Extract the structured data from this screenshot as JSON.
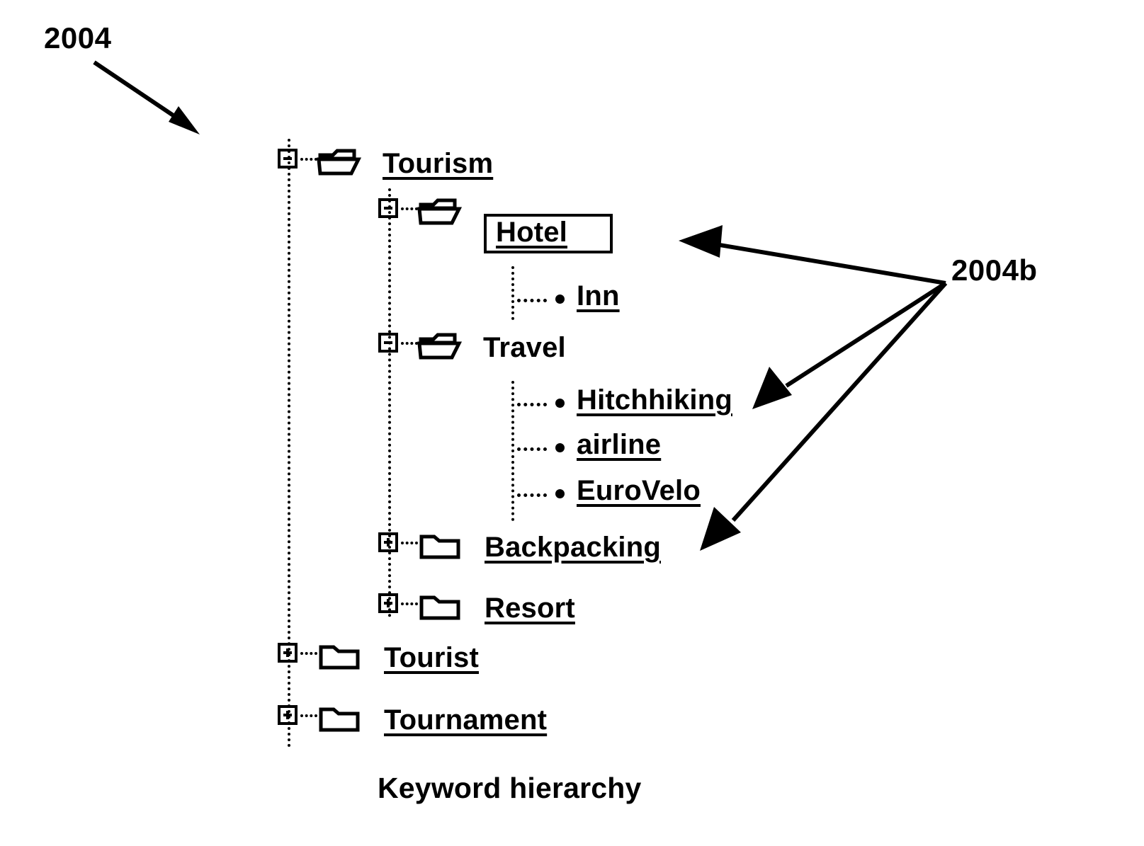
{
  "figure": {
    "caption": "Keyword hierarchy",
    "reference_numerals": {
      "tree": "2004",
      "callout": "2004b"
    }
  },
  "tree": {
    "root_label": "Tourism",
    "nodes": [
      {
        "id": "tourism",
        "label": "Tourism",
        "depth": 0,
        "type": "folder",
        "state": "expanded",
        "expander": "minus",
        "folder_icon": "open-folder-icon",
        "underlined": true,
        "selected": false
      },
      {
        "id": "hotel",
        "label": "Hotel",
        "depth": 1,
        "type": "folder",
        "state": "expanded",
        "expander": "minus",
        "folder_icon": "open-folder-icon",
        "underlined": true,
        "selected": true
      },
      {
        "id": "inn",
        "label": "Inn",
        "depth": 2,
        "type": "leaf",
        "state": "leaf",
        "expander": "none",
        "folder_icon": "bullet-icon",
        "underlined": true,
        "selected": false
      },
      {
        "id": "travel",
        "label": "Travel",
        "depth": 1,
        "type": "folder",
        "state": "expanded",
        "expander": "minus",
        "folder_icon": "open-folder-icon",
        "underlined": false,
        "selected": false
      },
      {
        "id": "hitchhiking",
        "label": "Hitchhiking",
        "depth": 2,
        "type": "leaf",
        "state": "leaf",
        "expander": "none",
        "folder_icon": "bullet-icon",
        "underlined": true,
        "selected": false
      },
      {
        "id": "airline",
        "label": "airline",
        "depth": 2,
        "type": "leaf",
        "state": "leaf",
        "expander": "none",
        "folder_icon": "bullet-icon",
        "underlined": true,
        "selected": false
      },
      {
        "id": "eurovelo",
        "label": "EuroVelo",
        "depth": 2,
        "type": "leaf",
        "state": "leaf",
        "expander": "none",
        "folder_icon": "bullet-icon",
        "underlined": true,
        "selected": false
      },
      {
        "id": "backpacking",
        "label": "Backpacking",
        "depth": 1,
        "type": "folder",
        "state": "collapsed",
        "expander": "plus",
        "folder_icon": "closed-folder-icon",
        "underlined": true,
        "selected": false
      },
      {
        "id": "resort",
        "label": "Resort",
        "depth": 1,
        "type": "folder",
        "state": "collapsed",
        "expander": "plus",
        "folder_icon": "closed-folder-icon",
        "underlined": true,
        "selected": false
      },
      {
        "id": "tourist",
        "label": "Tourist",
        "depth": 0,
        "type": "folder",
        "state": "collapsed",
        "expander": "plus",
        "folder_icon": "closed-folder-icon",
        "underlined": true,
        "selected": false
      },
      {
        "id": "tournament",
        "label": "Tournament",
        "depth": 0,
        "type": "folder",
        "state": "collapsed",
        "expander": "plus",
        "folder_icon": "closed-folder-icon",
        "underlined": true,
        "selected": false
      }
    ]
  },
  "annotations": {
    "tree_pointer": {
      "label": "2004",
      "points_to": "Tourism"
    },
    "callout_pointer": {
      "label": "2004b",
      "points_to": [
        "Hotel",
        "Hitchhiking",
        "Backpacking"
      ],
      "arrow_count": 3
    }
  },
  "colors": {
    "ink": "#000000",
    "background": "#ffffff"
  }
}
